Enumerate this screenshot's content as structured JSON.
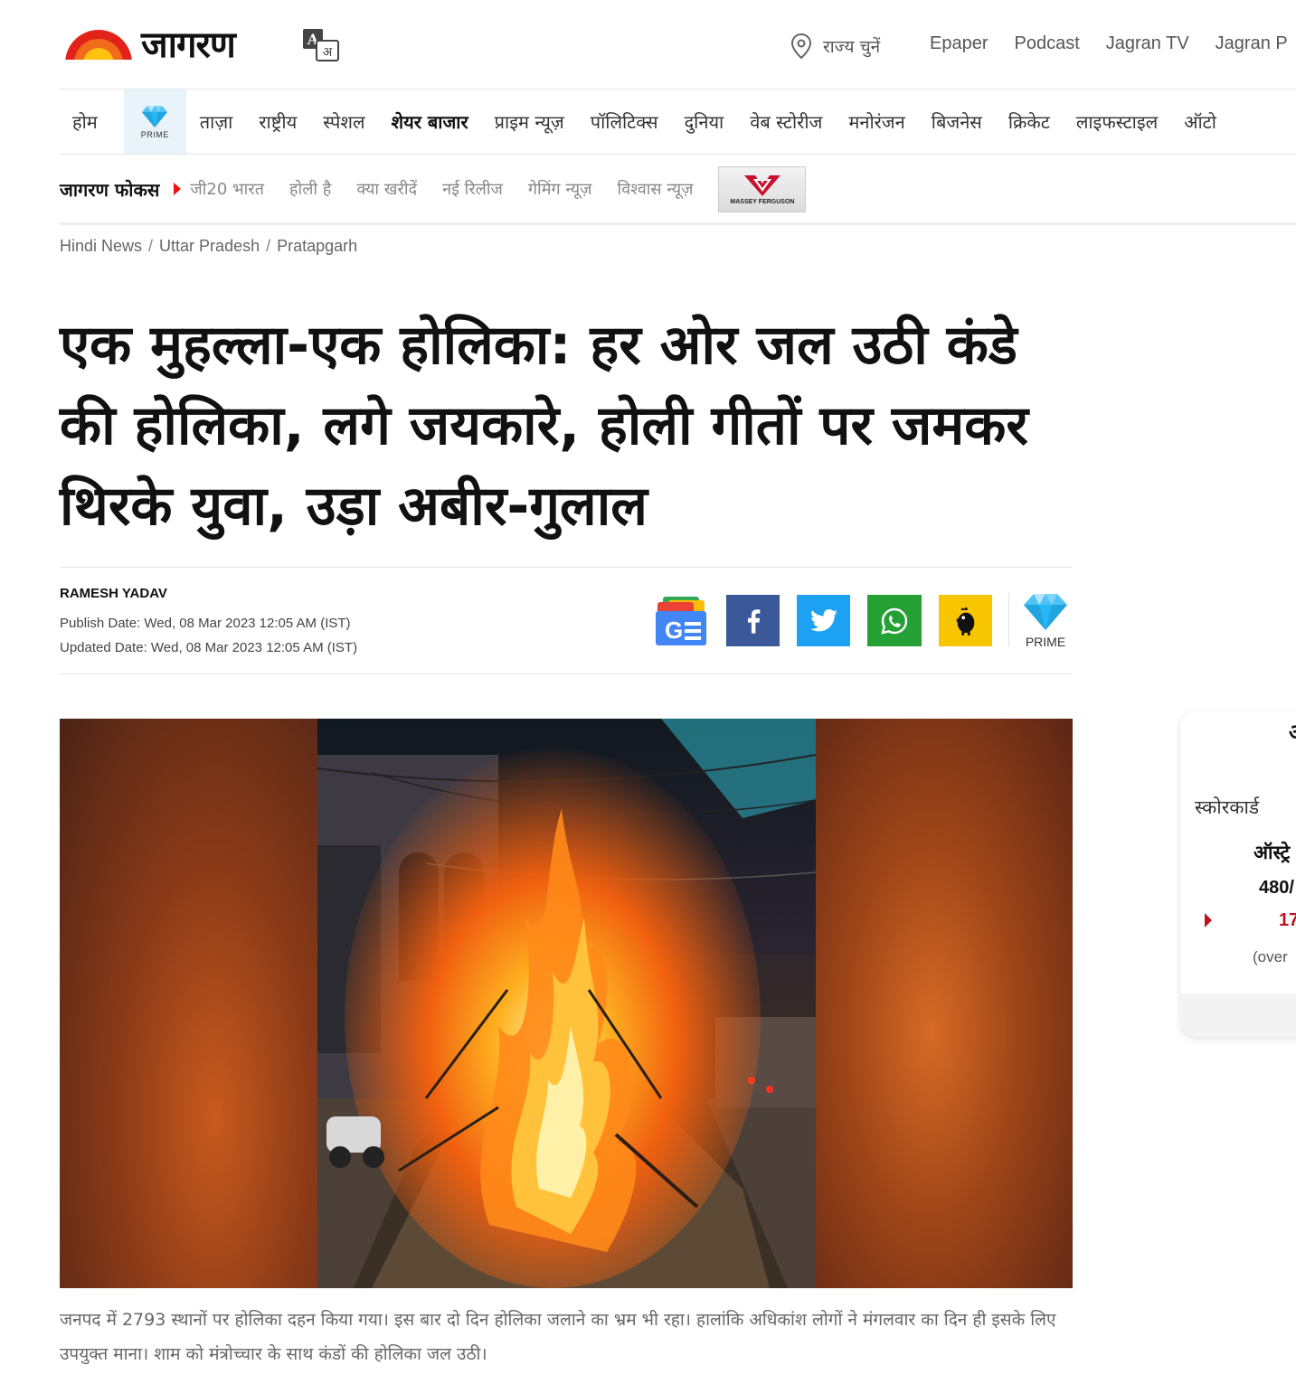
{
  "header": {
    "logo_text": "जागरण",
    "location_label": "राज्य चुनें",
    "links": [
      "Epaper",
      "Podcast",
      "Jagran TV",
      "Jagran P"
    ]
  },
  "nav": {
    "items": [
      {
        "label": "होम"
      },
      {
        "label": "PRIME",
        "type": "prime"
      },
      {
        "label": "ताज़ा"
      },
      {
        "label": "राष्ट्रीय"
      },
      {
        "label": "स्पेशल"
      },
      {
        "label": "शेयर बाजार",
        "bold": true
      },
      {
        "label": "प्राइम न्यूज़"
      },
      {
        "label": "पॉलिटिक्स"
      },
      {
        "label": "दुनिया"
      },
      {
        "label": "वेब स्टोरीज"
      },
      {
        "label": "मनोरंजन"
      },
      {
        "label": "बिजनेस"
      },
      {
        "label": "क्रिकेट"
      },
      {
        "label": "लाइफस्टाइल"
      },
      {
        "label": "ऑटो"
      }
    ]
  },
  "focus": {
    "title": "जागरण फोकस",
    "tags": [
      "जी20 भारत",
      "होली है",
      "क्या खरीदें",
      "नई रिलीज",
      "गेमिंग न्यूज़",
      "विश्वास न्यूज़"
    ],
    "ad_brand": "MASSEY FERGUSON"
  },
  "breadcrumb": [
    "Hindi News",
    "Uttar Pradesh",
    "Pratapgarh"
  ],
  "article": {
    "headline": "एक मुहल्ला-एक होलिका: हर ओर जल उठी कंडे की होलिका, लगे जयकारे, होली गीतों पर जमकर थिरके युवा, उड़ा अबीर-गुलाल",
    "author": "RAMESH YADAV",
    "publish_date": "Publish Date: Wed, 08 Mar 2023 12:05 AM (IST)",
    "updated_date": "Updated Date: Wed, 08 Mar 2023 12:05 AM (IST)",
    "prime_label": "PRIME",
    "caption": "जनपद में 2793 स्थानों पर होलिका दहन किया गया। इस बार दो दिन होलिका जलाने का भ्रम भी रहा। हालांकि अधिकांश लोगों ने मंगलवार का दिन ही इसके लिए उपयुक्त माना। शाम को मंत्रोच्चार के साथ कंडों की होलिका जल उठी।"
  },
  "share_icons": [
    "google-news-icon",
    "facebook-icon",
    "twitter-icon",
    "whatsapp-icon",
    "koo-icon"
  ],
  "widget": {
    "header": "अ",
    "score_label": "स्कोरकार्ड",
    "team": "ऑस्ट्रे",
    "runs": "480/",
    "live_score": "17",
    "overs": "(over"
  },
  "colors": {
    "facebook": "#3b5998",
    "twitter": "#1da1f2",
    "whatsapp": "#25a035",
    "koo": "#f7c600",
    "focus_marker": "#ee1111",
    "live_red": "#c0111f",
    "prime_blue": "#1fa6e0"
  }
}
